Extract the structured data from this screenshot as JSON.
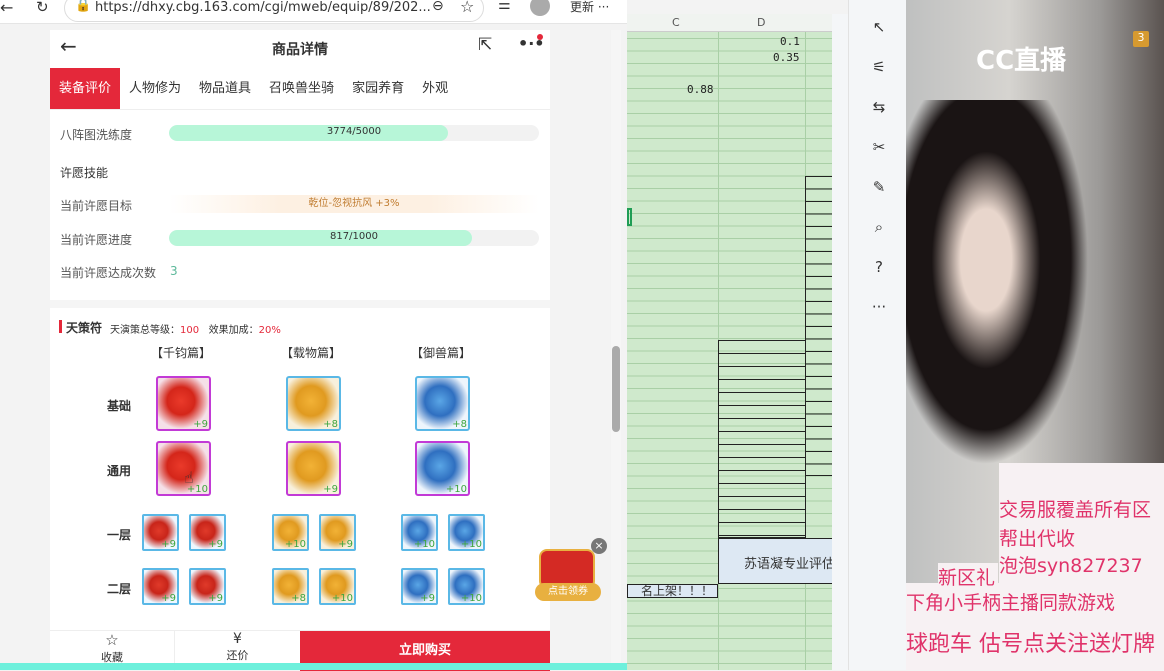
{
  "browser": {
    "url": "https://dhxy.cbg.163.com/cgi/mweb/equip/89/202...",
    "update_label": "更新",
    "more": "···"
  },
  "header": {
    "title": "商品详情"
  },
  "tabs": [
    "装备评价",
    "人物修为",
    "物品道具",
    "召唤兽坐骑",
    "家园养育",
    "外观"
  ],
  "stats": {
    "bazhen_label": "八阵图洗练度",
    "bazhen_value": "3774/5000",
    "bazhen_fraction": 0.7548,
    "wish_heading": "许愿技能",
    "wish_target_label": "当前许愿目标",
    "wish_target_value": "乾位-忽视抗风 +3%",
    "wish_progress_label": "当前许愿进度",
    "wish_progress_value": "817/1000",
    "wish_progress_fraction": 0.817,
    "wish_count_label": "当前许愿达成次数",
    "wish_count_value": "3"
  },
  "tiance": {
    "title": "天策符",
    "level_label": "天演策总等级：",
    "level_value": "100",
    "bonus_label": "效果加成：",
    "bonus_value": "20%",
    "columns": [
      "【千钧篇】",
      "【载物篇】",
      "【御兽篇】"
    ],
    "rows": [
      {
        "label": "基础",
        "plus": [
          "+9",
          "+8",
          "+8"
        ]
      },
      {
        "label": "通用",
        "plus": [
          "+10",
          "+9",
          "+10"
        ]
      },
      {
        "label": "一层",
        "plus": [
          "+9",
          "+9",
          "+10",
          "+9",
          "+10",
          "+10"
        ]
      },
      {
        "label": "二层",
        "plus": [
          "+9",
          "+9",
          "+8",
          "+10",
          "+9",
          "+10"
        ]
      }
    ]
  },
  "coupon": {
    "label": "点击领券"
  },
  "bottom": {
    "favorite": "收藏",
    "bargain": "还价",
    "buy": "立即购买"
  },
  "sheet": {
    "col_c": "C",
    "col_d": "D",
    "d1": "0.1",
    "d2": "0.35",
    "c3": "0.88",
    "eval_cell": "苏语凝专业评估",
    "notice_cell": "名上架！！！"
  },
  "stream": {
    "logo": "CC直播",
    "badge": "3",
    "lines": [
      "交易服覆盖所有区",
      "帮出代收",
      "泡泡syn827237",
      "新区礼",
      "下角小手柄主播同款游戏",
      "球跑车  估号点关注送灯牌"
    ]
  }
}
